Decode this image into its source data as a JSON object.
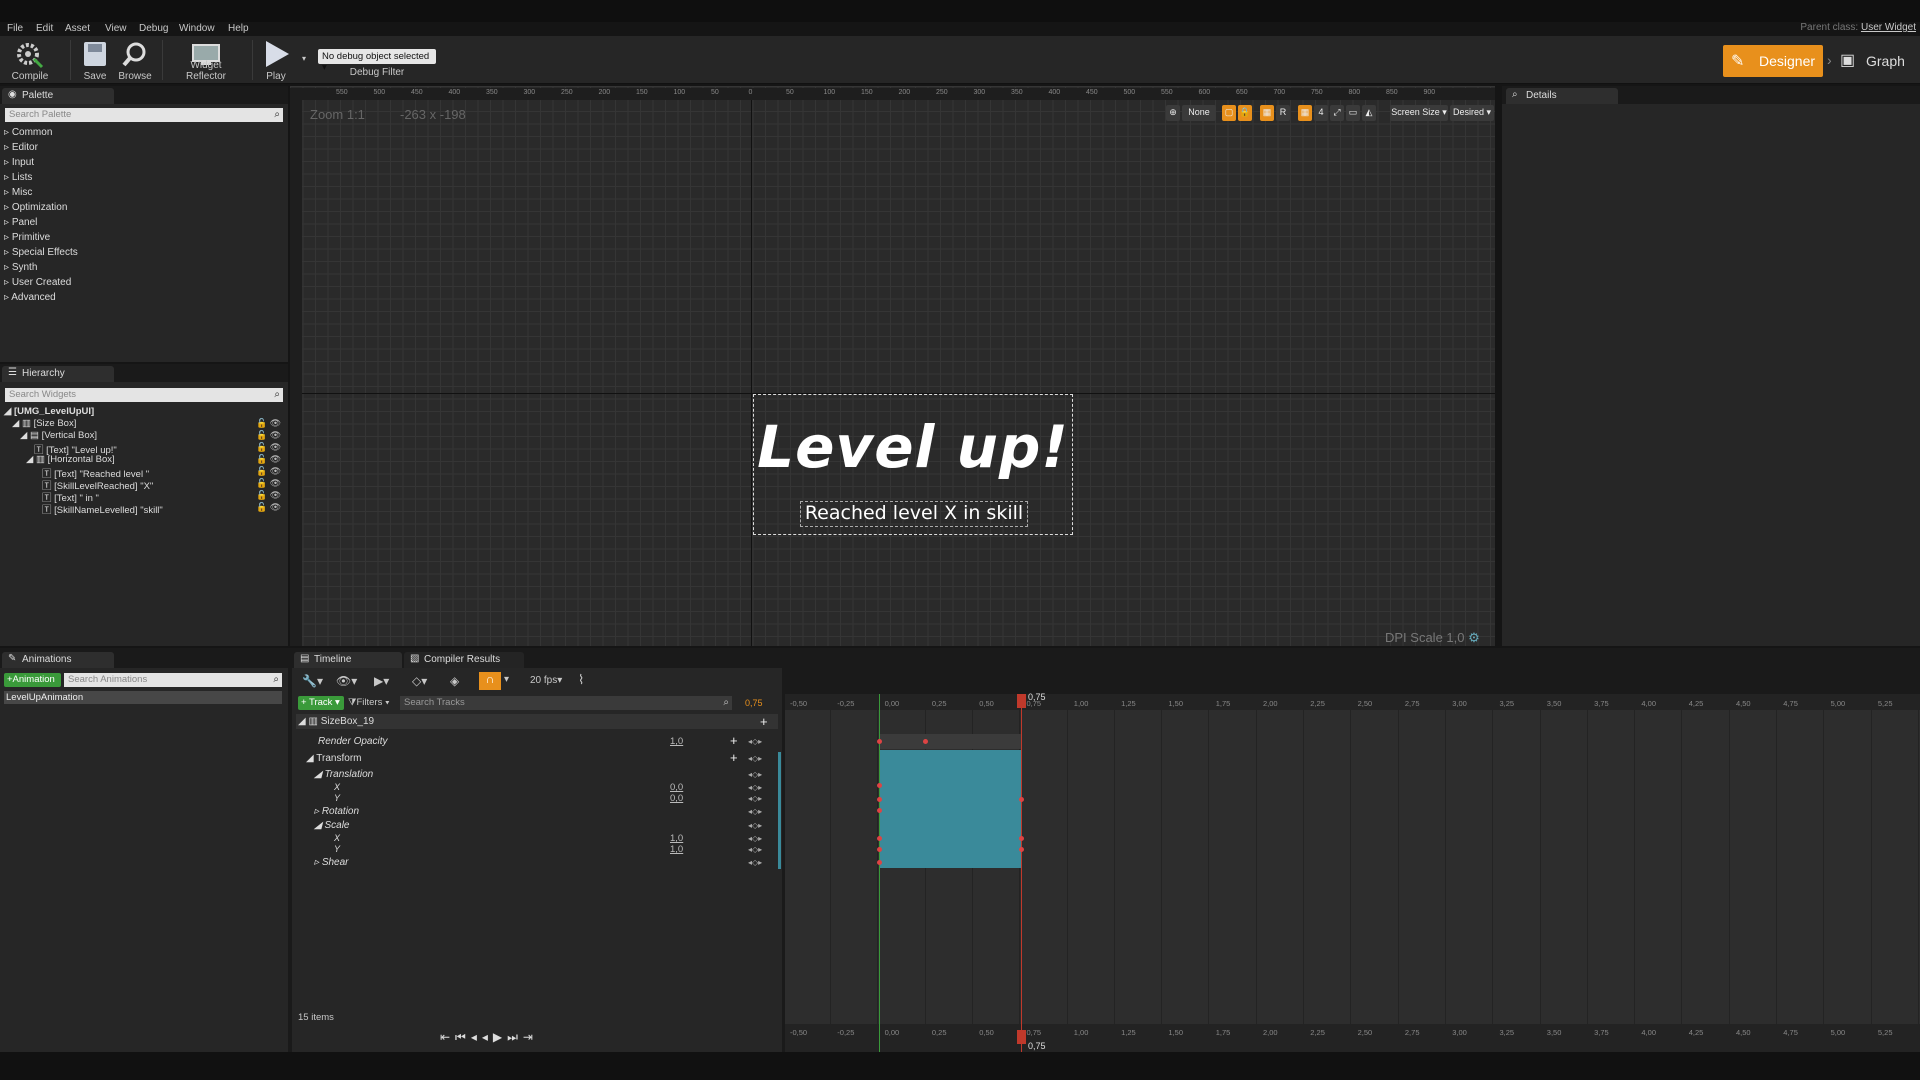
{
  "menu": [
    "File",
    "Edit",
    "Asset",
    "View",
    "Debug",
    "Window",
    "Help"
  ],
  "parent_class": {
    "label": "Parent class:",
    "value": "User Widget"
  },
  "toolbar": {
    "compile": "Compile",
    "save": "Save",
    "browse": "Browse",
    "widget_reflector": "Widget Reflector",
    "play": "Play",
    "debug_object": "No debug object selected",
    "debug_filter": "Debug Filter"
  },
  "modes": {
    "designer": "Designer",
    "graph": "Graph"
  },
  "palette": {
    "tab": "Palette",
    "search_placeholder": "Search Palette",
    "categories": [
      "Common",
      "Editor",
      "Input",
      "Lists",
      "Misc",
      "Optimization",
      "Panel",
      "Primitive",
      "Special Effects",
      "Synth",
      "User Created",
      "Advanced"
    ]
  },
  "hierarchy": {
    "tab": "Hierarchy",
    "search_placeholder": "Search Widgets",
    "items": [
      "[UMG_LevelUpUI]",
      "[Size Box]",
      "[Vertical Box]",
      "[Text] \"Level up!\"",
      "[Horizontal Box]",
      "[Text] \"Reached level \"",
      "[SkillLevelReached] \"X\"",
      "[Text] \" in \"",
      "[SkillNameLevelled] \"skill\""
    ]
  },
  "canvas": {
    "zoom": "Zoom 1:1",
    "size": "-263 x -198",
    "dpi": "DPI Scale 1,0",
    "title_text": "Level up!",
    "sub_text": "Reached level X in skill",
    "ruler_top": [
      "550",
      "500",
      "450",
      "400",
      "350",
      "300",
      "250",
      "200",
      "150",
      "100",
      "50",
      "0",
      "50",
      "100",
      "150",
      "200",
      "250",
      "300",
      "350",
      "400",
      "450",
      "500",
      "550",
      "600",
      "650",
      "700",
      "750",
      "800",
      "850",
      "900"
    ],
    "toolbar": {
      "none": "None",
      "r": "R",
      "four": "4",
      "screen_size": "Screen Size",
      "desired": "Desired"
    }
  },
  "details": {
    "tab": "Details"
  },
  "animations": {
    "tab": "Animations",
    "add": "+Animation",
    "search_placeholder": "Search Animations",
    "items": [
      "LevelUpAnimation"
    ]
  },
  "timeline": {
    "tab": "Timeline",
    "compiler_tab": "Compiler Results",
    "fps": "20 fps",
    "track_btn": "+ Track",
    "filters": "Filters",
    "search_placeholder": "Search Tracks",
    "current_time": "0,75",
    "items_count": "15 items",
    "ruler": [
      "-0,50",
      "-0,25",
      "0,00",
      "0,25",
      "0,50",
      "0,75",
      "1,00",
      "1,25",
      "1,50",
      "1,75",
      "2,00",
      "2,25",
      "2,50",
      "2,75",
      "3,00",
      "3,25",
      "3,50",
      "3,75",
      "4,00",
      "4,25",
      "4,50",
      "4,75",
      "5,00",
      "5,25"
    ],
    "tracks": [
      {
        "name": "SizeBox_19",
        "value": ""
      },
      {
        "name": "Render Opacity",
        "value": "1,0"
      },
      {
        "name": "Transform",
        "value": ""
      },
      {
        "name": "Translation",
        "value": ""
      },
      {
        "name": "X",
        "value": "0,0"
      },
      {
        "name": "Y",
        "value": "0,0"
      },
      {
        "name": "Rotation",
        "value": ""
      },
      {
        "name": "Scale",
        "value": ""
      },
      {
        "name": "X",
        "value": "1,0"
      },
      {
        "name": "Y",
        "value": "1,0"
      },
      {
        "name": "Shear",
        "value": ""
      }
    ]
  },
  "colors": {
    "accent": "#e8901c",
    "section": "#3a8a9a",
    "playhead": "#c0392b",
    "add_green": "#3a9a3a"
  }
}
